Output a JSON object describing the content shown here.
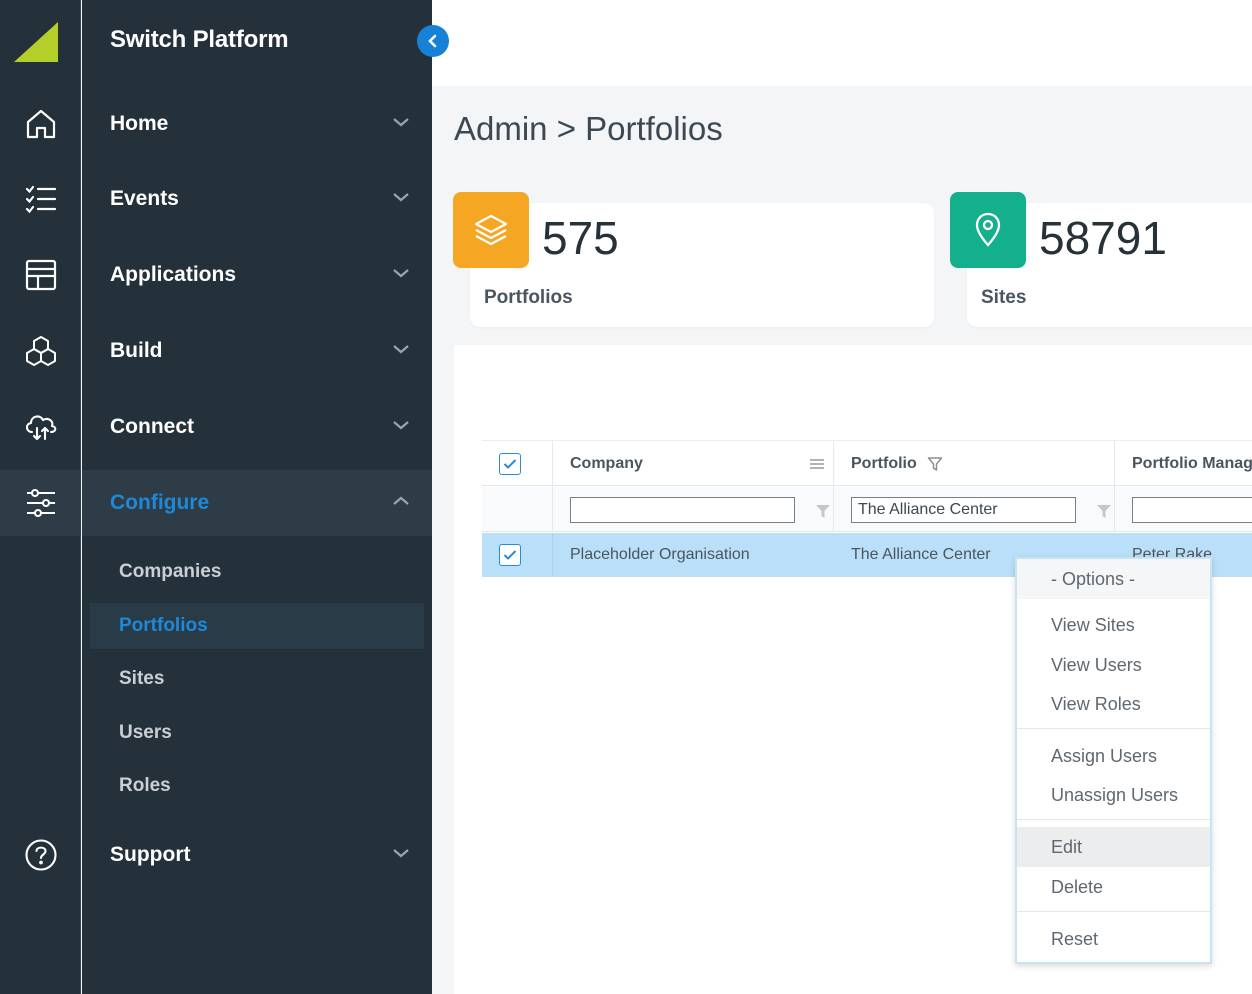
{
  "app": {
    "title": "Switch Platform"
  },
  "nav": {
    "items": [
      {
        "label": "Home",
        "icon": "home-icon"
      },
      {
        "label": "Events",
        "icon": "checklist-icon"
      },
      {
        "label": "Applications",
        "icon": "layout-icon"
      },
      {
        "label": "Build",
        "icon": "cubes-icon"
      },
      {
        "label": "Connect",
        "icon": "cloud-sync-icon"
      },
      {
        "label": "Configure",
        "icon": "sliders-icon",
        "active": true
      },
      {
        "label": "Support",
        "icon": "help-icon"
      }
    ],
    "sub_items": [
      {
        "label": "Companies"
      },
      {
        "label": "Portfolios",
        "active": true
      },
      {
        "label": "Sites"
      },
      {
        "label": "Users"
      },
      {
        "label": "Roles"
      }
    ]
  },
  "page": {
    "title": "Admin > Portfolios"
  },
  "stats": [
    {
      "value": "575",
      "label": "Portfolios",
      "color": "#f5a623",
      "icon": "layers-icon"
    },
    {
      "value": "58791",
      "label": "Sites",
      "color": "#14b08e",
      "icon": "map-pin-icon"
    }
  ],
  "grid": {
    "columns": [
      "Company",
      "Portfolio",
      "Portfolio Manager"
    ],
    "filters": [
      "",
      "The Alliance Center",
      ""
    ],
    "rows": [
      {
        "company": "Placeholder Organisation",
        "portfolio": "The Alliance Center",
        "manager": "Peter Rake",
        "selected": true
      }
    ]
  },
  "context_menu": {
    "header": "- Options -",
    "groups": [
      [
        "View Sites",
        "View Users",
        "View Roles"
      ],
      [
        "Assign Users",
        "Unassign Users"
      ],
      [
        "Edit",
        "Delete"
      ],
      [
        "Reset"
      ]
    ],
    "highlighted": "Edit"
  },
  "colors": {
    "sidebar_bg": "#24313a",
    "accent": "#1e88d9",
    "selected_row": "#b9e0f8",
    "logo": "#b5cf2a"
  }
}
